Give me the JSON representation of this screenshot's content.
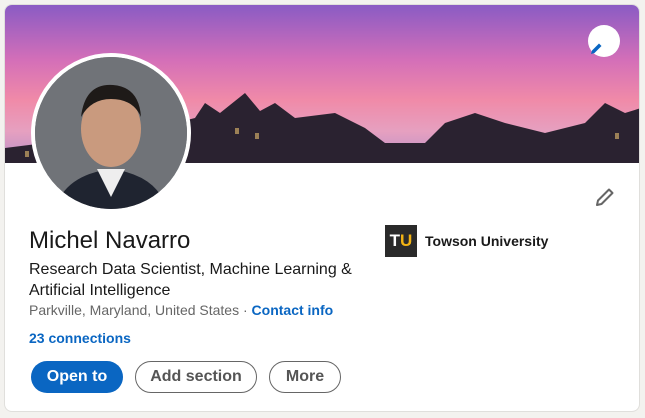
{
  "profile": {
    "name": "Michel Navarro",
    "headline": "Research Data Scientist, Machine Learning & Artificial Intelligence",
    "location": "Parkville, Maryland, United States",
    "separator": " · ",
    "contact_info": "Contact info",
    "connections": "23 connections"
  },
  "education": {
    "name": "Towson University",
    "logo_text_t": "T",
    "logo_text_u": "U"
  },
  "actions": {
    "open_to": "Open to",
    "add_section": "Add section",
    "more": "More"
  },
  "colors": {
    "accent": "#0a66c2",
    "logo_gold": "#f2b314"
  }
}
